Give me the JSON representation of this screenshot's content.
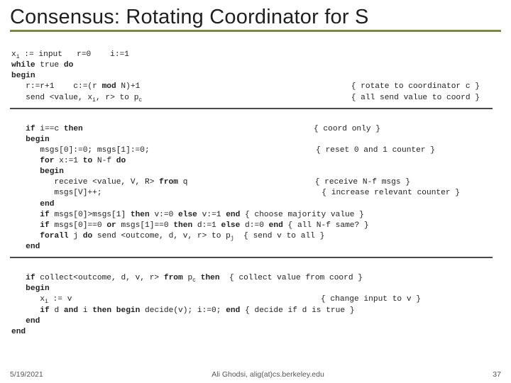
{
  "title": "Consensus: Rotating Coordinator for S",
  "block1": {
    "l1a": "x",
    "l1sub": "i",
    "l1b": " := input   r=0    i:=1",
    "l2a": "while",
    "l2b": " true ",
    "l2c": "do",
    "l3": "begin",
    "l4a": "   r:=r+1    c:=(r ",
    "l4b": "mod",
    "l4c": " N)+1",
    "l4r": "{ rotate to coordinator c }",
    "l5a": "   send <value, x",
    "l5sub": "i",
    "l5b": ", r> to p",
    "l5sub2": "c",
    "l5r": "{ all send value to coord }"
  },
  "block2": {
    "l1a": "   ",
    "l1b": "if",
    "l1c": " i==c ",
    "l1d": "then",
    "l1r": "{ coord only }",
    "l2": "   begin",
    "l3": "      msgs[0]:=0; msgs[1]:=0;",
    "l3r": "{ reset 0 and 1 counter }",
    "l4a": "      ",
    "l4b": "for",
    "l4c": " x:=1 ",
    "l4d": "to",
    "l4e": " N-f ",
    "l4f": "do",
    "l5": "      begin",
    "l6a": "         receive <value, V, R> ",
    "l6b": "from",
    "l6c": " q",
    "l6r": "{ receive N-f msgs }",
    "l7": "         msgs[V]++;",
    "l7r": "{ increase relevant counter }",
    "l8": "      end",
    "l9a": "      ",
    "l9b": "if",
    "l9c": " msgs[0]>msgs[1] ",
    "l9d": "then",
    "l9e": " v:=0 ",
    "l9f": "else",
    "l9g": " v:=1 ",
    "l9h": "end",
    "l9r": " { choose majority value }",
    "l10a": "      ",
    "l10b": "if",
    "l10c": " msgs[0]==0 ",
    "l10d": "or",
    "l10e": " msgs[1]==0 ",
    "l10f": "then",
    "l10g": " d:=1 ",
    "l10h": "else",
    "l10i": " d:=0 ",
    "l10j": "end",
    "l10r": " { all N-f same? }",
    "l11a": "      ",
    "l11b": "forall",
    "l11c": " j ",
    "l11d": "do",
    "l11e": " send <outcome, d, v, r> to p",
    "l11sub": "j",
    "l11r": "  { send v to all }",
    "l12": "   end"
  },
  "block3": {
    "l1a": "   ",
    "l1b": "if",
    "l1c": " collect<outcome, d, v, r> ",
    "l1d": "from",
    "l1e": " p",
    "l1sub": "c",
    "l1f": " ",
    "l1g": "then",
    "l1r": "  { collect value from coord }",
    "l2": "   begin",
    "l3a": "      x",
    "l3sub": "i",
    "l3b": " := v",
    "l3r": "{ change input to v }",
    "l4a": "      ",
    "l4b": "if",
    "l4c": " d ",
    "l4d": "and",
    "l4e": " i ",
    "l4f": "then begin",
    "l4g": " decide(v); i:=0; ",
    "l4h": "end",
    "l4r": " { decide if d is true }",
    "l5": "   end",
    "l6": "end"
  },
  "footer": {
    "date": "5/19/2021",
    "author": "Ali Ghodsi, alig(at)cs.berkeley.edu",
    "page": "37"
  }
}
